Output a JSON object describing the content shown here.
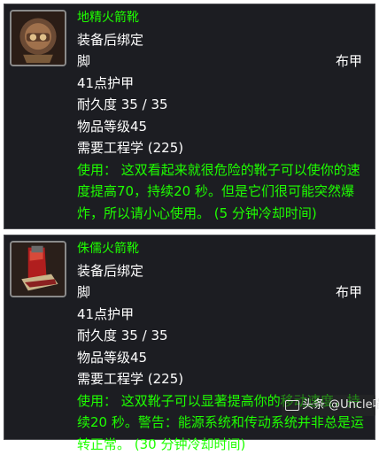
{
  "items": [
    {
      "icon": "goblin-rocket-boots-icon",
      "name": "地精火箭靴",
      "bind": "装备后绑定",
      "slot": "脚",
      "armor_type": "布甲",
      "armor": "41点护甲",
      "durability": "耐久度 35 / 35",
      "item_level": "物品等级45",
      "requires": "需要工程学 (225)",
      "use": "使用： 这双看起来就很危险的靴子可以使你的速度提高70，持续20 秒。但是它们很可能突然爆炸，所以请小心使用。 (5 分钟冷却时间)"
    },
    {
      "icon": "gnomish-rocket-boots-icon",
      "name": "侏儒火箭靴",
      "bind": "装备后绑定",
      "slot": "脚",
      "armor_type": "布甲",
      "armor": "41点护甲",
      "durability": "耐久度 35 / 35",
      "item_level": "物品等级45",
      "requires": "需要工程学 (225)",
      "use": "使用： 这双靴子可以显著提高你的移动速度，持续20 秒。警告：能源系统和传动系统并非总是运转正常。 (30 分钟冷却时间)"
    }
  ],
  "watermark": "头条 @Uncle喵喵",
  "colors": {
    "panel_bg": "#1c1d22",
    "name_green": "#1eff00",
    "text_white": "#ffffff"
  }
}
